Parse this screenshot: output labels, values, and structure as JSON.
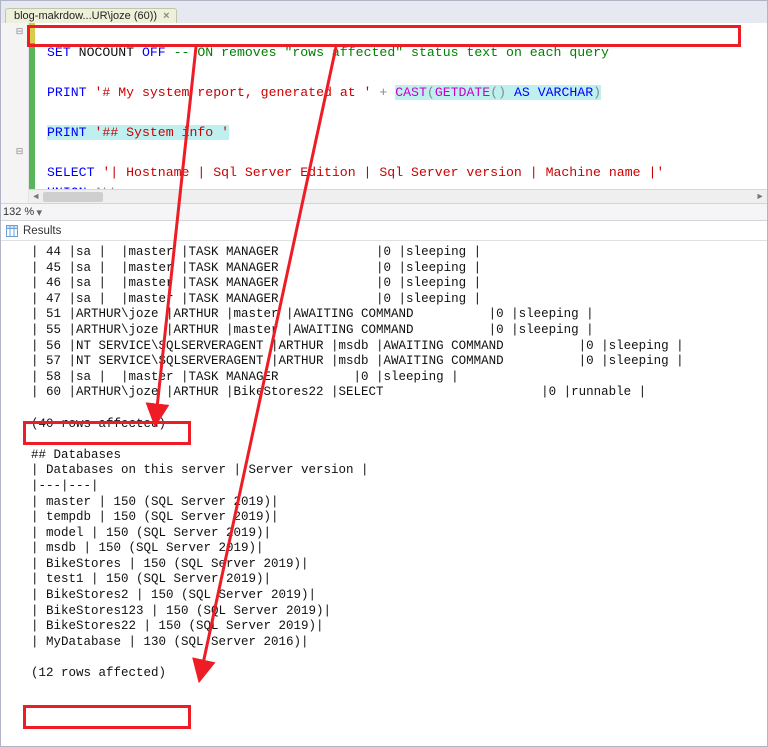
{
  "tab": {
    "title": "blog-makrdow...UR\\joze (60))",
    "close": "×"
  },
  "zoom": {
    "value": "132 %",
    "expander": "▾"
  },
  "resultsHeader": {
    "label": "Results"
  },
  "code": {
    "l1a": "SET",
    "l1b": " NOCOUNT ",
    "l1c": "OFF",
    "l1d": " -- ON removes \"rows affected\" status text on each query",
    "l2": " ",
    "l3a": "PRINT",
    "l3b": " '# My system report, generated at '",
    "l3c": " + ",
    "l3d": "CAST",
    "l3e": "(",
    "l3f": "GETDATE",
    "l3g": "()",
    "l3h": " AS",
    "l3i": " VARCHAR",
    "l3j": ")",
    "l4": " ",
    "l5a": "PRINT",
    "l5b": " '## System info '",
    "l6": " ",
    "l7a": "SELECT",
    "l7b": " '| Hostname | Sql Server Edition | Sql Server version | Machine name |'",
    "l8a": "UNION",
    "l8b": " ALL"
  },
  "resultLines": [
    "| 44 |sa |  |master |TASK MANAGER             |0 |sleeping |",
    "| 45 |sa |  |master |TASK MANAGER             |0 |sleeping |",
    "| 46 |sa |  |master |TASK MANAGER             |0 |sleeping |",
    "| 47 |sa |  |master |TASK MANAGER             |0 |sleeping |",
    "| 51 |ARTHUR\\joze |ARTHUR |master |AWAITING COMMAND          |0 |sleeping |",
    "| 55 |ARTHUR\\joze |ARTHUR |master |AWAITING COMMAND          |0 |sleeping |",
    "| 56 |NT SERVICE\\SQLSERVERAGENT |ARTHUR |msdb |AWAITING COMMAND          |0 |sleeping |",
    "| 57 |NT SERVICE\\SQLSERVERAGENT |ARTHUR |msdb |AWAITING COMMAND          |0 |sleeping |",
    "| 58 |sa |  |master |TASK MANAGER          |0 |sleeping |",
    "| 60 |ARTHUR\\joze |ARTHUR |BikeStores22 |SELECT                     |0 |runnable |",
    "",
    "(40 rows affected)",
    "",
    "## Databases",
    "| Databases on this server | Server version |",
    "|---|---|",
    "| master | 150 (SQL Server 2019)|",
    "| tempdb | 150 (SQL Server 2019)|",
    "| model | 150 (SQL Server 2019)|",
    "| msdb | 150 (SQL Server 2019)|",
    "| BikeStores | 150 (SQL Server 2019)|",
    "| test1 | 150 (SQL Server 2019)|",
    "| BikeStores2 | 150 (SQL Server 2019)|",
    "| BikeStores123 | 150 (SQL Server 2019)|",
    "| BikeStores22 | 150 (SQL Server 2019)|",
    "| MyDatabase | 130 (SQL Server 2016)|",
    "",
    "(12 rows affected)",
    ""
  ]
}
